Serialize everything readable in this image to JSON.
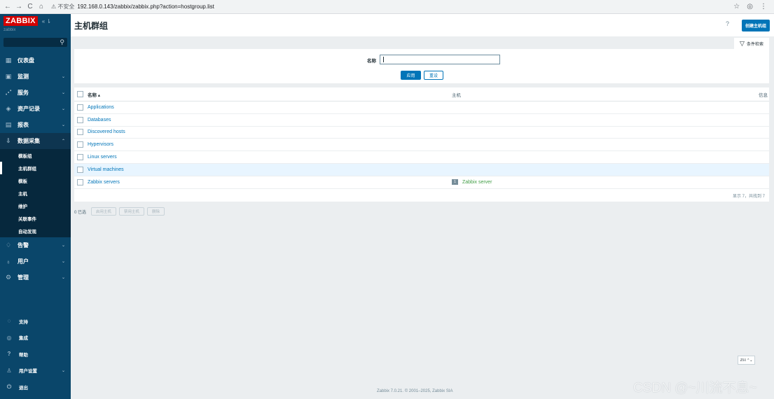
{
  "browser": {
    "back": "←",
    "forward": "→",
    "reload": "C",
    "home": "⌂",
    "security_warning": "不安全",
    "url": "192.168.0.143/zabbix/zabbix.php?action=hostgroup.list",
    "star": "☆",
    "profile": "◎",
    "menu": "⋮"
  },
  "sidebar": {
    "logo": "ZABBIX",
    "collapse_ctrl": "« ⇂",
    "subtitle": "zabbix",
    "search_icon": "⚲",
    "menu": [
      {
        "label": "仪表盘",
        "icon": "dashboard-icon",
        "glyph": "▦"
      },
      {
        "label": "监测",
        "icon": "monitoring-icon",
        "glyph": "▣",
        "chevron": "⌄"
      },
      {
        "label": "服务",
        "icon": "services-icon",
        "glyph": "⋰",
        "chevron": "⌄"
      },
      {
        "label": "资产记录",
        "icon": "inventory-icon",
        "glyph": "◈",
        "chevron": "⌄"
      },
      {
        "label": "报表",
        "icon": "reports-icon",
        "glyph": "▤",
        "chevron": "⌄"
      },
      {
        "label": "数据采集",
        "icon": "data-collection-icon",
        "glyph": "⇩",
        "chevron": "⌃"
      }
    ],
    "submenu": [
      "模板组",
      "主机群组",
      "模板",
      "主机",
      "维护",
      "关联事件",
      "自动发现"
    ],
    "menu2": [
      {
        "label": "告警",
        "icon": "alerts-icon",
        "glyph": "♢",
        "chevron": "⌄"
      },
      {
        "label": "用户",
        "icon": "users-icon",
        "glyph": "♁",
        "chevron": "⌄"
      },
      {
        "label": "管理",
        "icon": "administration-icon",
        "glyph": "⚙",
        "chevron": "⌄"
      }
    ],
    "bottom": [
      {
        "label": "支持",
        "icon": "support-icon",
        "glyph": "◌"
      },
      {
        "label": "集成",
        "icon": "integrations-icon",
        "glyph": "◎"
      },
      {
        "label": "帮助",
        "icon": "help-icon",
        "glyph": "?"
      },
      {
        "label": "用户设置",
        "icon": "user-settings-icon",
        "glyph": "♙",
        "chevron": "⌄"
      },
      {
        "label": "退出",
        "icon": "sign-out-icon",
        "glyph": "⏻"
      }
    ]
  },
  "header": {
    "title": "主机群组",
    "help": "?",
    "create_button": "创建主机组"
  },
  "filter": {
    "tab_label": "条件检索",
    "tab_icon": "▽",
    "name_label": "名称",
    "name_value": "",
    "apply": "应用",
    "reset": "重设"
  },
  "table": {
    "col_name": "名称 ▴",
    "col_hosts": "主机",
    "col_info": "信息",
    "rows": [
      {
        "name": "Applications"
      },
      {
        "name": "Databases"
      },
      {
        "name": "Discovered hosts"
      },
      {
        "name": "Hypervisors"
      },
      {
        "name": "Linux servers"
      },
      {
        "name": "Virtual machines"
      },
      {
        "name": "Zabbix servers",
        "host_count": "1",
        "host": "Zabbix server"
      }
    ],
    "footer": "显示 7，共找到 7"
  },
  "actions": {
    "selected": "0 已选",
    "enable": "启用主机",
    "disable": "禁用主机",
    "delete": "删除"
  },
  "lang": "ℤℍ ⌃⌄",
  "footer": "Zabbix 7.0.21. © 2001–2025, Zabbix SIA",
  "watermark": "CSDN @~川流不息~",
  "colors": {
    "sidebar": "#0a466a",
    "accent": "#0275b8",
    "logo": "#d40000",
    "host_link": "#429e47"
  }
}
